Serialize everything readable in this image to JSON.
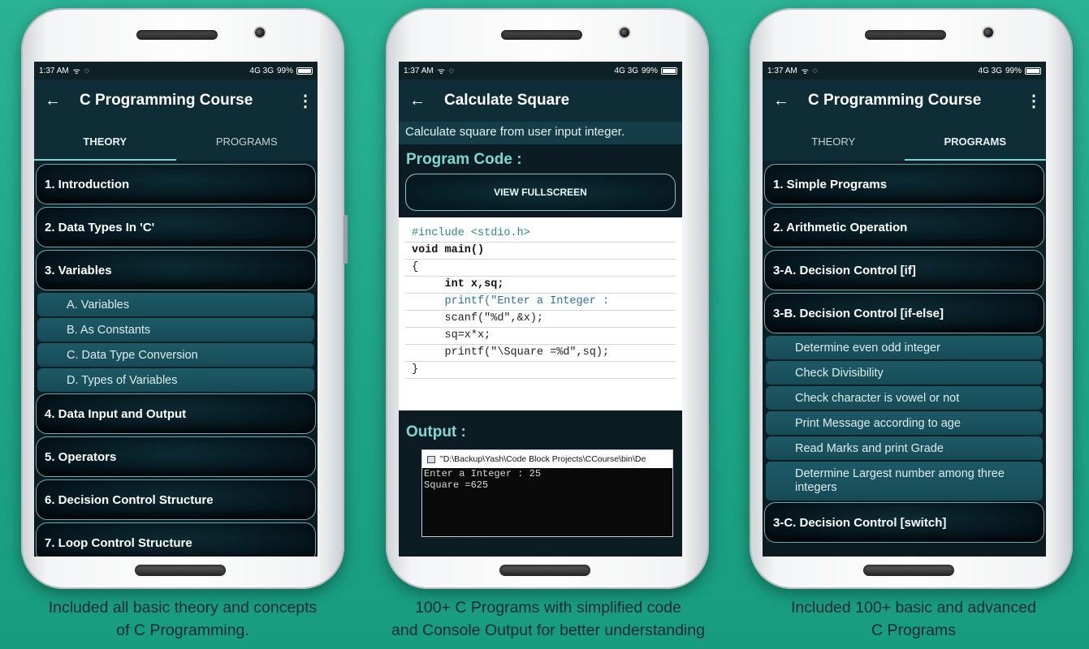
{
  "colors": {
    "background": "#20a889",
    "accent": "#7fd6cf",
    "appbar": "#0f2d36"
  },
  "status": {
    "time": "1:37 AM",
    "signal": "4G 3G",
    "battery": "99%"
  },
  "phone1": {
    "title": "C Programming Course",
    "tabs": [
      "THEORY",
      "PROGRAMS"
    ],
    "active_tab": "THEORY",
    "items": [
      {
        "label": "1. Introduction"
      },
      {
        "label": "2. Data Types In 'C'"
      },
      {
        "label": "3. Variables",
        "sub": [
          "A. Variables",
          "B. As Constants",
          "C. Data Type Conversion",
          "D. Types of Variables"
        ]
      },
      {
        "label": "4. Data Input and Output"
      },
      {
        "label": "5. Operators"
      },
      {
        "label": "6. Decision Control Structure"
      },
      {
        "label": "7. Loop Control Structure"
      }
    ],
    "caption": [
      "Included all basic theory and concepts",
      "of C Programming."
    ]
  },
  "phone2": {
    "title": "Calculate Square",
    "description": "Calculate square from user input integer.",
    "code_heading": "Program Code :",
    "view_button": "VIEW FULLSCREEN",
    "code_lines": [
      "#include <stdio.h>",
      "void main()",
      "{",
      "     int x,sq;",
      "     printf(\"Enter a Integer :",
      "     scanf(\"%d\",&x);",
      "     sq=x*x;",
      "     printf(\"\\Square =%d\",sq);",
      "}"
    ],
    "output_heading": "Output :",
    "console_title": "\"D:\\Backup\\Yash\\Code Block Projects\\CCourse\\bin\\De",
    "console_lines": [
      "Enter a Integer : 25",
      "Square =625"
    ],
    "caption": [
      "100+ C Programs with simplified code",
      "and Console Output for better understanding"
    ]
  },
  "phone3": {
    "title": "C Programming Course",
    "tabs": [
      "THEORY",
      "PROGRAMS"
    ],
    "active_tab": "PROGRAMS",
    "items": [
      {
        "label": "1. Simple Programs"
      },
      {
        "label": "2. Arithmetic Operation"
      },
      {
        "label": "3-A. Decision Control [if]"
      },
      {
        "label": "3-B. Decision Control [if-else]",
        "sub": [
          "Determine even odd integer",
          "Check Divisibility",
          "Check character is vowel or not",
          "Print Message according to age",
          "Read Marks and print Grade",
          "Determine Largest number among three integers"
        ]
      },
      {
        "label": "3-C. Decision Control [switch]"
      }
    ],
    "caption": [
      "Included 100+ basic and advanced",
      "C Programs"
    ]
  }
}
